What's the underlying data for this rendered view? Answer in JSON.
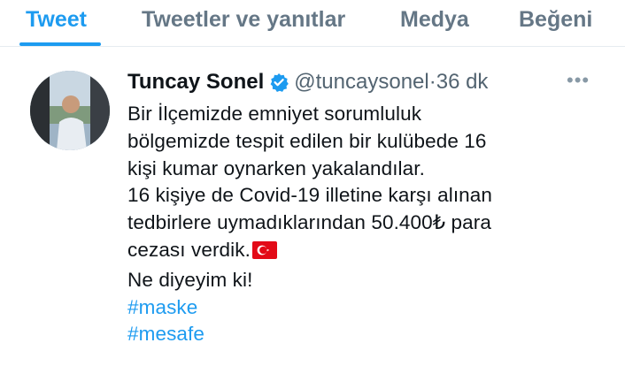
{
  "tabs": [
    {
      "label": "Tweet",
      "active": true
    },
    {
      "label": "Tweetler ve yanıtlar",
      "active": false
    },
    {
      "label": "Medya",
      "active": false
    },
    {
      "label": "Beğeni",
      "active": false
    }
  ],
  "tweet": {
    "author_name": "Tuncay Sonel",
    "handle": "@tuncaysonel",
    "separator": "·",
    "time": "36 dk",
    "more_icon": "more-horizontal-icon",
    "lines": [
      "Bir İlçemizde emniyet sorumluluk",
      "bölgemizde tespit edilen bir kulübede 16",
      "kişi kumar oynarken yakalandılar.",
      "16 kişiye de Covid-19 illetine karşı alınan",
      "tedbirlere uymadıklarından 50.400₺ para",
      "cezası verdik.",
      "Ne diyeyim ki!"
    ],
    "emoji": "turkey-flag",
    "hashtags": [
      "#maske",
      "#mesafe"
    ]
  },
  "colors": {
    "accent": "#1d9bf0",
    "text": "#0f1419",
    "muted": "#536471",
    "verified": "#1d9bf0",
    "flag_red": "#e30a17"
  }
}
